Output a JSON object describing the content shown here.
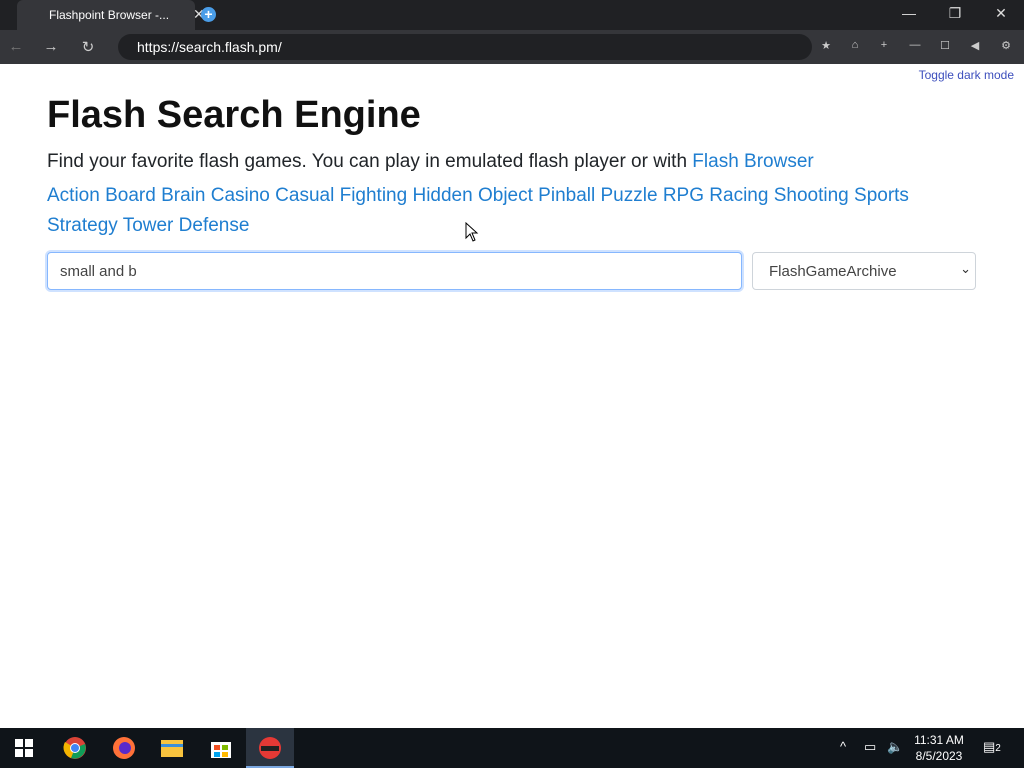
{
  "browser": {
    "tab_title": "Flashpoint Browser -...",
    "url": "https://search.flash.pm/"
  },
  "page": {
    "toggle": "Toggle dark mode",
    "title": "Flash Search Engine",
    "intro": "Find your favorite flash games. You can play in emulated flash player or with ",
    "browser_link": "Flash Browser",
    "categories": [
      "Action",
      "Board",
      "Brain",
      "Casino",
      "Casual",
      "Fighting",
      "Hidden Object",
      "Pinball",
      "Puzzle",
      "RPG",
      "Racing",
      "Shooting",
      "Sports",
      "Strategy",
      "Tower Defense"
    ],
    "search_value": "small and b",
    "archive": "FlashGameArchive"
  },
  "taskbar": {
    "time": "11:31 AM",
    "date": "8/5/2023",
    "notif": "2"
  },
  "colors": {
    "link": "#1f7ed0"
  }
}
